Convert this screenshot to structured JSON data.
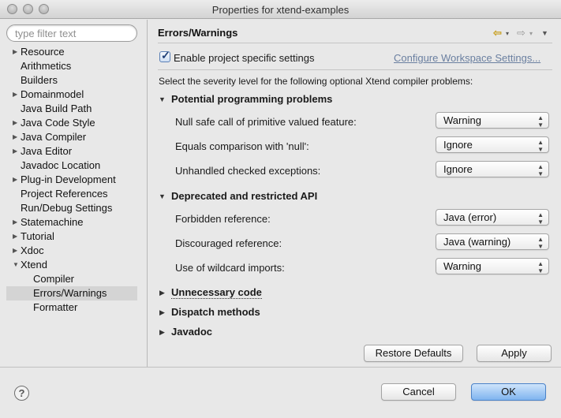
{
  "window": {
    "title": "Properties for xtend-examples"
  },
  "filter": {
    "placeholder": "type filter text",
    "value": ""
  },
  "tree": [
    {
      "label": "Resource",
      "expander": "▶",
      "level": 0
    },
    {
      "label": "Arithmetics",
      "expander": "",
      "level": 0
    },
    {
      "label": "Builders",
      "expander": "",
      "level": 0
    },
    {
      "label": "Domainmodel",
      "expander": "▶",
      "level": 0
    },
    {
      "label": "Java Build Path",
      "expander": "",
      "level": 0
    },
    {
      "label": "Java Code Style",
      "expander": "▶",
      "level": 0
    },
    {
      "label": "Java Compiler",
      "expander": "▶",
      "level": 0
    },
    {
      "label": "Java Editor",
      "expander": "▶",
      "level": 0
    },
    {
      "label": "Javadoc Location",
      "expander": "",
      "level": 0
    },
    {
      "label": "Plug-in Development",
      "expander": "▶",
      "level": 0
    },
    {
      "label": "Project References",
      "expander": "",
      "level": 0
    },
    {
      "label": "Run/Debug Settings",
      "expander": "",
      "level": 0
    },
    {
      "label": "Statemachine",
      "expander": "▶",
      "level": 0
    },
    {
      "label": "Tutorial",
      "expander": "▶",
      "level": 0
    },
    {
      "label": "Xdoc",
      "expander": "▶",
      "level": 0
    },
    {
      "label": "Xtend",
      "expander": "▼",
      "level": 0
    },
    {
      "label": "Compiler",
      "expander": "",
      "level": 1
    },
    {
      "label": "Errors/Warnings",
      "expander": "",
      "level": 1,
      "selected": true
    },
    {
      "label": "Formatter",
      "expander": "",
      "level": 1
    }
  ],
  "page": {
    "title": "Errors/Warnings",
    "enable_specific": {
      "checked": true,
      "label": "Enable project specific settings"
    },
    "configure_link": "Configure Workspace Settings...",
    "description": "Select the severity level for the following optional Xtend compiler problems:",
    "groups": [
      {
        "title": "Potential programming problems",
        "expanded": true,
        "options": [
          {
            "label": "Null safe call of primitive valued feature:",
            "value": "Warning"
          },
          {
            "label": "Equals comparison with 'null':",
            "value": "Ignore"
          },
          {
            "label": "Unhandled checked exceptions:",
            "value": "Ignore"
          }
        ]
      },
      {
        "title": "Deprecated and restricted API",
        "expanded": true,
        "options": [
          {
            "label": "Forbidden reference:",
            "value": "Java (error)"
          },
          {
            "label": "Discouraged reference:",
            "value": "Java (warning)"
          },
          {
            "label": "Use of wildcard imports:",
            "value": "Warning"
          }
        ]
      },
      {
        "title": "Unnecessary code",
        "expanded": false,
        "options": []
      },
      {
        "title": "Dispatch methods",
        "expanded": false,
        "options": []
      },
      {
        "title": "Javadoc",
        "expanded": false,
        "options": []
      }
    ],
    "restore_defaults": "Restore Defaults",
    "apply": "Apply"
  },
  "footer": {
    "help": "?",
    "cancel": "Cancel",
    "ok": "OK"
  },
  "icons": {
    "back": "back-arrow-icon",
    "forward": "forward-arrow-icon",
    "view_menu": "view-menu-icon",
    "help": "help-icon",
    "expand": "triangle-right-icon",
    "collapse": "triangle-down-icon"
  },
  "colors": {
    "ok_button": "#7fb4ef",
    "link": "#6a7fa0",
    "selection": "#d4d4d4"
  }
}
